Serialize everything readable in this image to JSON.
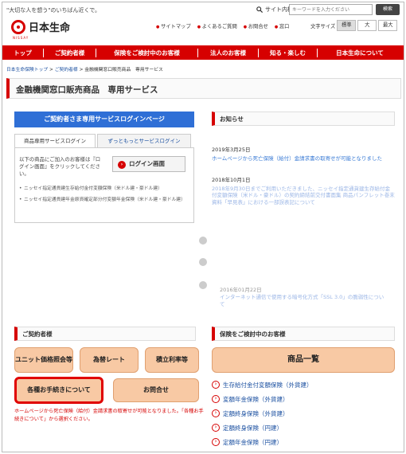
{
  "header": {
    "tagline": "\"大切な人を想う\"のいちばん近くで。",
    "logo_text": "日本生命",
    "logo_sub": "NISSAY",
    "search_label": "サイト内検索",
    "search_placeholder": "キーワードを入力ください",
    "search_button": "検索",
    "util_links": [
      "サイトマップ",
      "よくあるご質問",
      "お問合せ",
      "窓口"
    ],
    "font_size_label": "文字サイズ",
    "font_sizes": [
      "標準",
      "大",
      "最大"
    ]
  },
  "nav": [
    "トップ",
    "ご契約者様",
    "保険をご検討中のお客様",
    "法人のお客様",
    "知る・楽しむ",
    "日本生命について"
  ],
  "breadcrumb": {
    "items": [
      "日本生命保険トップ",
      "ご契約者様",
      "金融機関窓口販売商品　専用サービス"
    ]
  },
  "page_title": "金融機関窓口販売商品　専用サービス",
  "login_section": {
    "blue_button": "ご契約者さま専用サービスログインページ",
    "tabs": [
      "商品専用サービスログイン",
      "ずっともっとサービスログイン"
    ],
    "panel_text": "以下の商品にご加入のお客様は『ログイン画面』をクリックしてください。",
    "login_button": "ログイン画面",
    "bullets": [
      "ニッセイ指定通貨建生存給付金付変額保険（米ドル建・豪ドル建）",
      "ニッセイ指定通貨建年金原資確定部分付変額年金保険（米ドル建・豪ドル建）"
    ]
  },
  "news": {
    "heading": "お知らせ",
    "items": [
      {
        "date": "2019年3月25日",
        "text": "ホームページから死亡保険（給付）金請求書の取寄せが可能となりました"
      },
      {
        "date": "2018年10月1日",
        "text": "2018年9月30日までご利用いただきました、ニッセイ指定通貨建生存給付金付変額保険（米ドル・豪ドル）の契約締結前交付書面集 商品パンフレット巻末資料「早見表」における一部誤表記について"
      },
      {
        "date": "2016年01月22日",
        "text": "インターネット通信で使用する暗号化方式「SSL 3.0」の脆弱性について"
      }
    ]
  },
  "contract_section": {
    "heading": "ご契約者様",
    "buttons": [
      "ユニット価格照会等",
      "為替レート",
      "積立利率等",
      "各種お手続きについて",
      "お問合せ"
    ],
    "warning": "ホームページから死亡保険（給付）金請求書の取寄せが可能となりました。「各種お手続きについて」から選択ください。"
  },
  "consider_section": {
    "heading": "保険をご検討中のお客様",
    "product_button": "商品一覧",
    "products": [
      "生存給付金付変額保険（外貨建）",
      "変額年金保険（外貨建）",
      "定額終身保険（外貨建）",
      "定額終身保険（円建）",
      "定額年金保険（円建）"
    ]
  },
  "colors": {
    "brand_red": "#d60000",
    "blue": "#2f6fd6",
    "orange_button": "#f8c9a4"
  }
}
